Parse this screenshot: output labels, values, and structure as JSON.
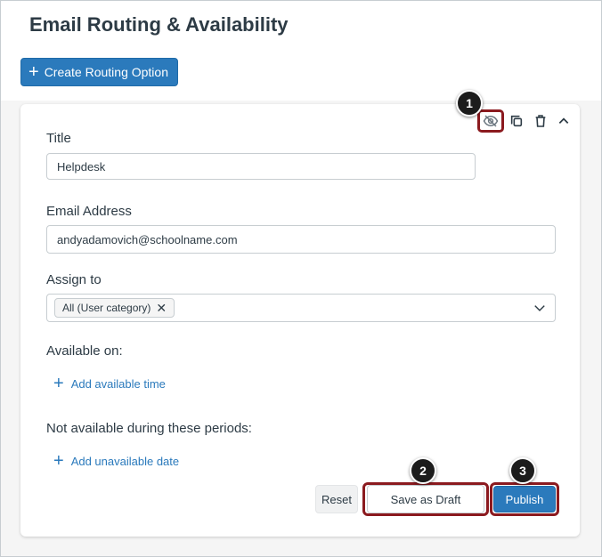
{
  "page": {
    "title": "Email Routing & Availability"
  },
  "toolbar": {
    "create_label": "Create Routing Option"
  },
  "card_actions": {
    "icons": [
      "eye-off-icon",
      "copy-icon",
      "trash-icon",
      "chevron-up-icon"
    ]
  },
  "form": {
    "title_label": "Title",
    "title_value": "Helpdesk",
    "email_label": "Email Address",
    "email_value": "andyadamovich@schoolname.com",
    "assign_label": "Assign to",
    "assign_tag": "All (User category)",
    "available_label": "Available on:",
    "add_available_time": "Add available time",
    "unavailable_label": "Not available during these periods:",
    "add_unavailable_date": "Add unavailable date"
  },
  "buttons": {
    "reset": "Reset",
    "save_draft": "Save as Draft",
    "publish": "Publish"
  },
  "callouts": {
    "one": "1",
    "two": "2",
    "three": "3"
  },
  "colors": {
    "primary": "#2b7abc",
    "highlight": "#8b1a1f",
    "text": "#2d3b45"
  }
}
